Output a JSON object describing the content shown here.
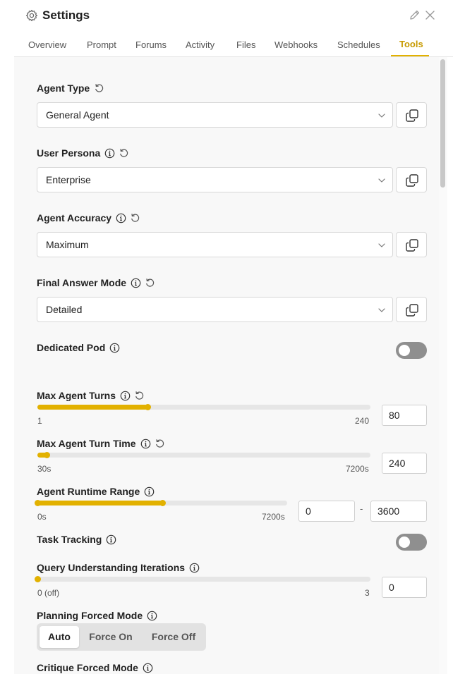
{
  "header": {
    "title": "Settings"
  },
  "tabs": [
    {
      "label": "Overview"
    },
    {
      "label": "Prompt"
    },
    {
      "label": "Forums"
    },
    {
      "label": "Activity"
    },
    {
      "label": "Files"
    },
    {
      "label": "Webhooks"
    },
    {
      "label": "Schedules"
    },
    {
      "label": "Tools",
      "active": true
    }
  ],
  "fields": {
    "agent_type": {
      "label": "Agent Type",
      "value": "General Agent"
    },
    "user_persona": {
      "label": "User Persona",
      "value": "Enterprise"
    },
    "agent_accuracy": {
      "label": "Agent Accuracy",
      "value": "Maximum"
    },
    "final_answer_mode": {
      "label": "Final Answer Mode",
      "value": "Detailed"
    },
    "dedicated_pod": {
      "label": "Dedicated Pod",
      "on": false
    },
    "max_agent_turns": {
      "label": "Max Agent Turns",
      "min_label": "1",
      "max_label": "240",
      "value": "80",
      "min": 1,
      "max": 240
    },
    "max_agent_turn_time": {
      "label": "Max Agent Turn Time",
      "min_label": "30s",
      "max_label": "7200s",
      "value": "240",
      "min": 30,
      "max": 7200
    },
    "agent_runtime_range": {
      "label": "Agent Runtime Range",
      "min_label": "0s",
      "max_label": "7200s",
      "low": "0",
      "high": "3600",
      "separator": "-",
      "min": 0,
      "max": 7200
    },
    "task_tracking": {
      "label": "Task Tracking",
      "on": false
    },
    "query_understanding": {
      "label": "Query Understanding Iterations",
      "min_label": "0 (off)",
      "max_label": "3",
      "value": "0",
      "min": 0,
      "max": 3
    },
    "planning_forced_mode": {
      "label": "Planning Forced Mode",
      "options": [
        "Auto",
        "Force On",
        "Force Off"
      ],
      "selected": "Auto"
    },
    "critique_forced_mode": {
      "label": "Critique Forced Mode"
    }
  },
  "colors": {
    "accent": "#e2b100",
    "accent_text": "#c79a00",
    "toggle_off": "#8f8f8f"
  },
  "icons": {
    "header": [
      "gear-icon",
      "pencil-icon",
      "close-icon"
    ],
    "field": [
      "info-icon",
      "reset-icon",
      "chevron-down-icon",
      "copy-icon"
    ]
  }
}
